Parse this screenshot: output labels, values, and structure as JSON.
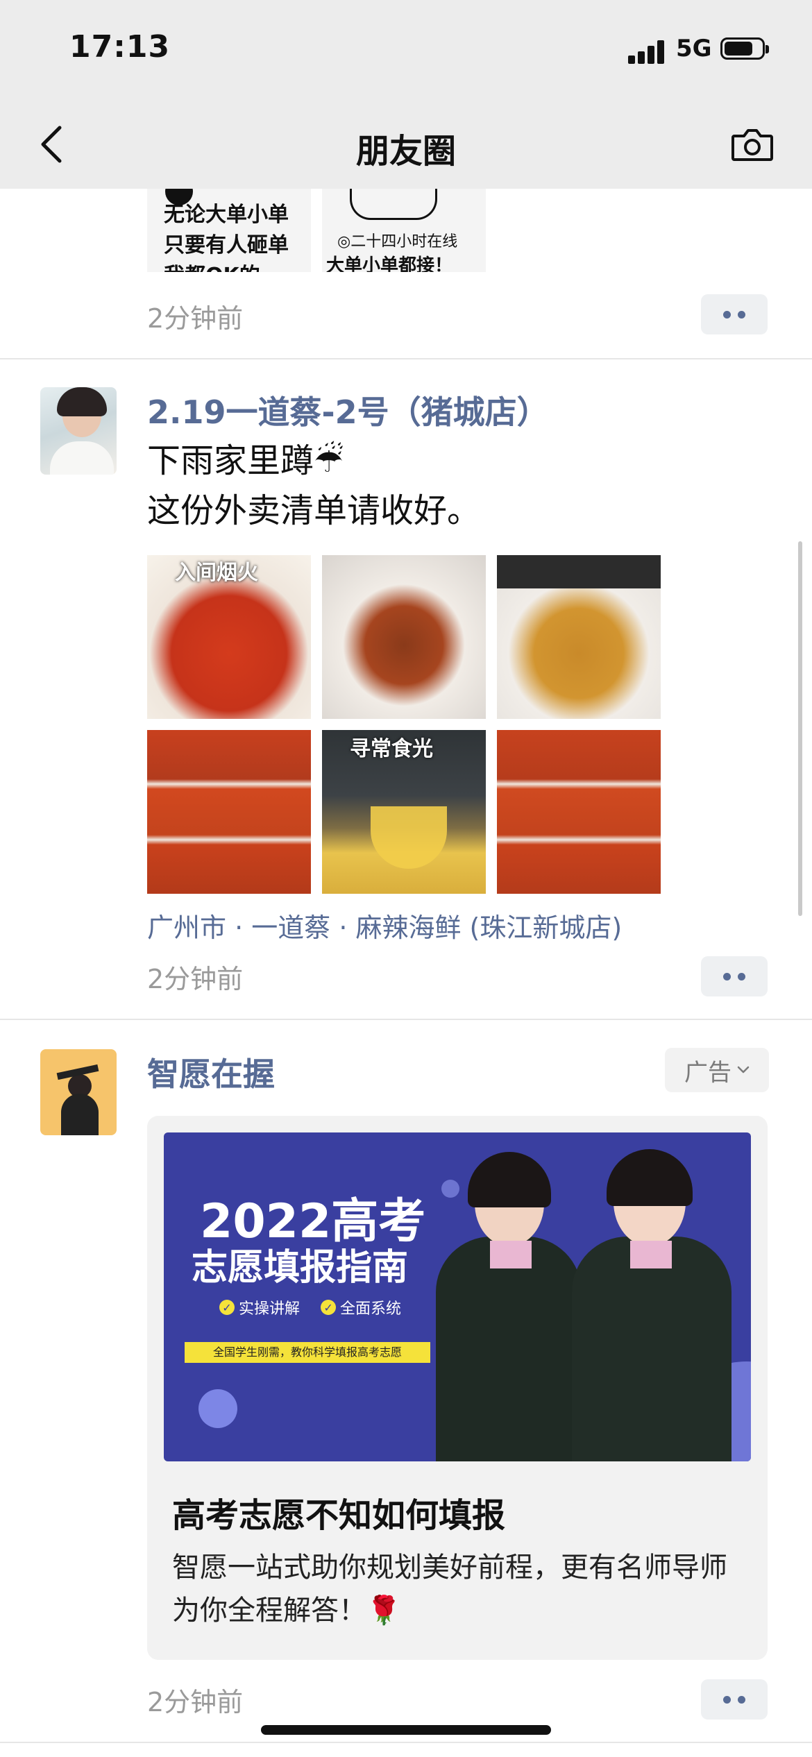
{
  "status_bar": {
    "time": "17:13",
    "network": "5G"
  },
  "nav": {
    "title": "朋友圈",
    "back_icon": "chevron-left-icon",
    "camera_icon": "camera-icon"
  },
  "post_partial": {
    "images": [
      {
        "lines": [
          "无论大单小单",
          "只要有人砸单",
          "我都OK的"
        ]
      },
      {
        "lines": [
          "◎二十四小时在线",
          "大单小单都接！"
        ]
      }
    ],
    "time": "2分钟前"
  },
  "post_food": {
    "username": "2.19一道蔡-2号（猪城店）",
    "text_line1": "下雨家里蹲☔",
    "text_line2": "这份外卖清单请收好。",
    "image_captions": [
      "入间烟火",
      "",
      "",
      "",
      "寻常食光",
      ""
    ],
    "location": "广州市 · 一道蔡 · 麻辣海鲜 (珠江新城店)",
    "time": "2分钟前"
  },
  "post_ad": {
    "username": "智愿在握",
    "ad_label": "广告",
    "banner": {
      "headline1": "2022高考",
      "headline2": "志愿填报指南",
      "check1": "实操讲解",
      "check2": "全面系统",
      "strip": "全国学生刚需，教你科学填报高考志愿"
    },
    "title": "高考志愿不知如何填报",
    "desc": "智愿一站式助你规划美好前程，更有名师导师为你全程解答！🌹",
    "time": "2分钟前"
  },
  "colors": {
    "link": "#576b95",
    "muted": "#9a9a9a",
    "banner_bg": "#3a3fa0",
    "strip": "#f5e23a"
  }
}
